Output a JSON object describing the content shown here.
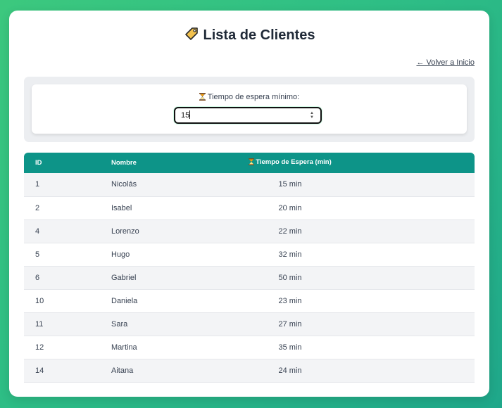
{
  "page": {
    "title": "Lista de Clientes",
    "back_link": "← Volver a Inicio"
  },
  "filter": {
    "label": "Tiempo de espera mínimo:",
    "value": "15"
  },
  "table": {
    "headers": {
      "id": "ID",
      "name": "Nombre",
      "wait": "Tiempo de Espera (min)"
    },
    "rows": [
      {
        "id": "1",
        "name": "Nicolás",
        "wait": "15 min"
      },
      {
        "id": "2",
        "name": "Isabel",
        "wait": "20 min"
      },
      {
        "id": "4",
        "name": "Lorenzo",
        "wait": "22 min"
      },
      {
        "id": "5",
        "name": "Hugo",
        "wait": "32 min"
      },
      {
        "id": "6",
        "name": "Gabriel",
        "wait": "50 min"
      },
      {
        "id": "10",
        "name": "Daniela",
        "wait": "23 min"
      },
      {
        "id": "11",
        "name": "Sara",
        "wait": "27 min"
      },
      {
        "id": "12",
        "name": "Martina",
        "wait": "35 min"
      },
      {
        "id": "14",
        "name": "Aitana",
        "wait": "24 min"
      }
    ]
  },
  "colors": {
    "accent": "#0d9488",
    "background": "#3cc87e"
  },
  "icons": {
    "title": "tag-icon",
    "filter": "hourglass-icon"
  }
}
